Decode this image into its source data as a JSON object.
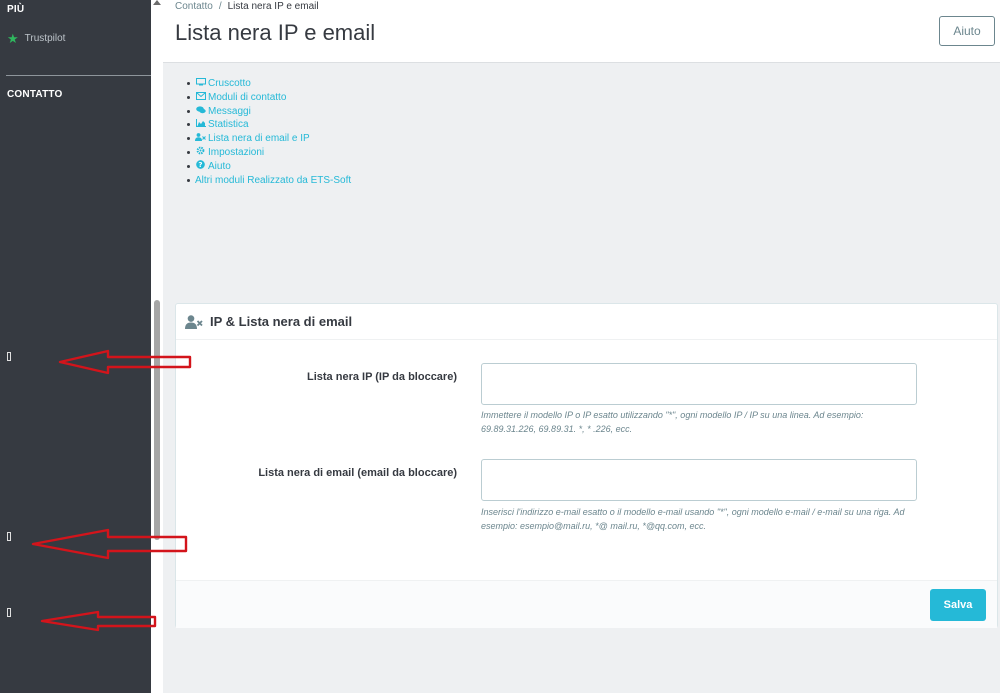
{
  "sidebar": {
    "section_more": "PIÙ",
    "trustpilot_label": "Trustpilot",
    "section_contact": "CONTATTO"
  },
  "header": {
    "breadcrumb_parent": "Contatto",
    "breadcrumb_separator": "/",
    "breadcrumb_current": "Lista nera IP e email",
    "title": "Lista nera IP e email",
    "help_label": "Aiuto"
  },
  "nav": {
    "items": [
      {
        "label": "Cruscotto",
        "icon": "monitor-icon"
      },
      {
        "label": "Moduli di contatto",
        "icon": "envelope-icon"
      },
      {
        "label": "Messaggi",
        "icon": "comments-icon"
      },
      {
        "label": "Statistica",
        "icon": "area-chart-icon"
      },
      {
        "label": "Lista nera di email e IP",
        "icon": "user-times-icon"
      },
      {
        "label": "Impostazioni",
        "icon": "gear-icon"
      },
      {
        "label": "Aiuto",
        "icon": "question-icon"
      },
      {
        "label": "Altri moduli Realizzato da ETS-Soft",
        "icon": ""
      }
    ]
  },
  "panel": {
    "title": "IP & Lista nera di email",
    "ip_label": "Lista nera IP (IP da bloccare)",
    "ip_value": "",
    "ip_help": "Immettere il modello IP o IP esatto utilizzando \"*\", ogni modello IP / IP su una linea. Ad esempio: 69.89.31.226, 69.89.31. *, * .226, ecc.",
    "email_label": "Lista nera di email (email da bloccare)",
    "email_value": "",
    "email_help": "Inserisci l'indirizzo e-mail esatto o il modello e-mail usando \"*\", ogni modello e-mail / e-mail su una riga. Ad esempio: esempio@mail.ru, *@ mail.ru, *@qq.com, ecc.",
    "save_label": "Salva"
  },
  "colors": {
    "accent": "#25b9d7",
    "sidebar_bg": "#363a41",
    "arrow_red": "#d3141b",
    "trustpilot_green": "#2fb75e"
  }
}
